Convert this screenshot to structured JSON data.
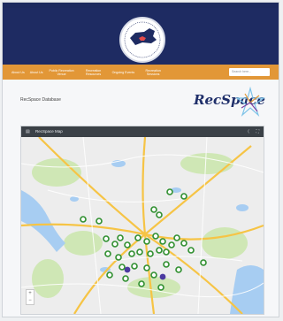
{
  "nav": {
    "items": [
      "About Us",
      "About Us",
      "Public Recreation Venue",
      "Recreation Resources",
      "Ongoing Events",
      "Recreation Sessions"
    ],
    "search_placeholder": "Search here..."
  },
  "page": {
    "title": "RecSpace Database",
    "brand_text": "RecSpace"
  },
  "map": {
    "header_title": "RecSpace Map",
    "zoom_in": "+",
    "zoom_out": "−",
    "marker_color": "#2f8f2f",
    "marker_color_alt": "#4b3aa0"
  },
  "colors": {
    "header_bg": "#1e2b62",
    "nav_bg": "#e29737",
    "map_road": "#f6c445",
    "map_water": "#a7cdf2",
    "map_park": "#cfe7b5"
  }
}
